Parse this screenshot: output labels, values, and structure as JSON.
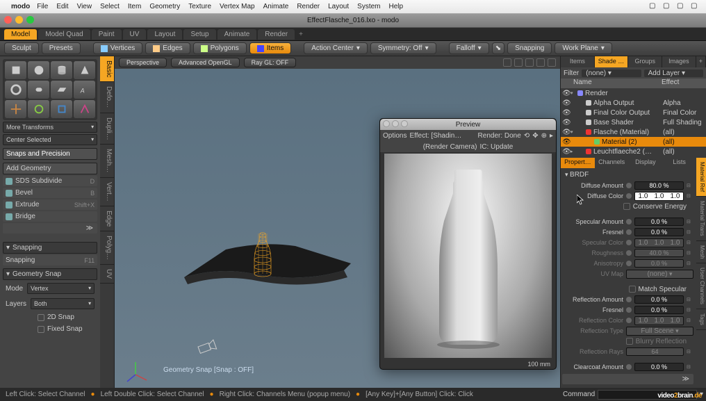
{
  "menubar": {
    "app": "modo",
    "items": [
      "File",
      "Edit",
      "View",
      "Select",
      "Item",
      "Geometry",
      "Texture",
      "Vertex Map",
      "Animate",
      "Render",
      "Layout",
      "System",
      "Help"
    ]
  },
  "window_title": "EffectFlasche_016.lxo - modo",
  "layout_tabs": [
    "Model",
    "Model Quad",
    "Paint",
    "UV",
    "Layout",
    "Setup",
    "Animate",
    "Render"
  ],
  "layout_active": 0,
  "left_toolbar": {
    "sculpt": "Sculpt",
    "presets": "Presets"
  },
  "select_modes": {
    "vertices": "Vertices",
    "edges": "Edges",
    "polygons": "Polygons",
    "items": "Items"
  },
  "toolbar": {
    "action_center": "Action Center",
    "symmetry": "Symmetry: Off",
    "falloff": "Falloff",
    "snapping": "Snapping",
    "workplane": "Work Plane"
  },
  "viewport_bar": {
    "perspective": "Perspective",
    "opengl": "Advanced OpenGL",
    "raygl": "Ray GL: OFF"
  },
  "left_panel": {
    "more_transforms": "More Transforms",
    "center_selected": "Center Selected",
    "snaps_precision": "Snaps and Precision",
    "add_geometry": "Add Geometry",
    "tools": [
      {
        "name": "SDS Subdivide",
        "sc": "D"
      },
      {
        "name": "Bevel",
        "sc": "B"
      },
      {
        "name": "Extrude",
        "sc": "Shift+X"
      },
      {
        "name": "Bridge",
        "sc": ""
      }
    ],
    "snapping_hdr": "Snapping",
    "snapping_btn": "Snapping",
    "snapping_sc": "F11",
    "geometry_snap": "Geometry Snap",
    "mode_label": "Mode",
    "mode_val": "Vertex",
    "layers_label": "Layers",
    "layers_val": "Both",
    "snap2d": "2D Snap",
    "fixed_snap": "Fixed Snap"
  },
  "viewport_status": "Geometry Snap  [Snap : OFF]",
  "preview": {
    "title": "Preview",
    "options": "Options",
    "effect": "Effect: [Shadin…",
    "render": "Render: Done",
    "camera_btn": "(Render Camera)",
    "ic_btn": "IC: Update",
    "scale": "100 mm"
  },
  "right_tabs_top": [
    "Items",
    "Shade …",
    "Groups",
    "Images"
  ],
  "right_tabs_top_active": 1,
  "filter": {
    "label": "Filter",
    "val": "(none)",
    "addlayer": "Add Layer"
  },
  "tree_hdr": {
    "name": "Name",
    "effect": "Effect"
  },
  "tree": [
    {
      "indent": 0,
      "icon": "#88f",
      "name": "Render",
      "effect": "",
      "tog": "▾"
    },
    {
      "indent": 1,
      "icon": "#ccc",
      "name": "Alpha Output",
      "effect": "Alpha"
    },
    {
      "indent": 1,
      "icon": "#ccc",
      "name": "Final Color Output",
      "effect": "Final Color"
    },
    {
      "indent": 1,
      "icon": "#ccc",
      "name": "Base Shader",
      "effect": "Full Shading"
    },
    {
      "indent": 1,
      "icon": "#e33",
      "name": "Flasche (Material)",
      "effect": "(all)",
      "tog": "▾"
    },
    {
      "indent": 2,
      "icon": "#6c6",
      "name": "Material (2)",
      "effect": "(all)",
      "sel": true
    },
    {
      "indent": 1,
      "icon": "#e33",
      "name": "Leuchtflaeche2 (…",
      "effect": "(all)",
      "tog": "▸"
    }
  ],
  "prop_tabs": [
    "Propert…",
    "Channels",
    "Display",
    "Lists"
  ],
  "prop_tabs_active": 0,
  "brdf": "BRDF",
  "props": {
    "diffuse_amount": {
      "label": "Diffuse Amount",
      "val": "80.0 %"
    },
    "diffuse_color": {
      "label": "Diffuse Color",
      "r": "1.0",
      "g": "1.0",
      "b": "1.0"
    },
    "conserve": "Conserve Energy",
    "specular_amount": {
      "label": "Specular Amount",
      "val": "0.0 %"
    },
    "fresnel": {
      "label": "Fresnel",
      "val": "0.0 %"
    },
    "specular_color": {
      "label": "Specular Color",
      "r": "1.0",
      "g": "1.0",
      "b": "1.0"
    },
    "roughness": {
      "label": "Roughness",
      "val": "40.0 %"
    },
    "anisotropy": {
      "label": "Anisotropy",
      "val": "0.0 %"
    },
    "uvmap": {
      "label": "UV Map",
      "val": "(none)"
    },
    "match_spec": "Match Specular",
    "refl_amount": {
      "label": "Reflection Amount",
      "val": "0.0 %"
    },
    "refl_fresnel": {
      "label": "Fresnel",
      "val": "0.0 %"
    },
    "refl_color": {
      "label": "Reflection Color",
      "r": "1.0",
      "g": "1.0",
      "b": "1.0"
    },
    "refl_type": {
      "label": "Reflection Type",
      "val": "Full Scene"
    },
    "blurry": "Blurry Reflection",
    "refl_rays": {
      "label": "Reflection Rays",
      "val": "64"
    },
    "clearcoat": {
      "label": "Clearcoat Amount",
      "val": "0.0 %"
    }
  },
  "right_side_tabs": [
    "Material Ref",
    "Material Trans",
    "Mesh",
    "User Channels",
    "Tags"
  ],
  "status": {
    "lc": "Left Click: Select Channel",
    "ldc": "Left Double Click: Select Channel",
    "rc": "Right Click: Channels Menu (popup menu)",
    "any": "[Any Key]+[Any Button] Click: Click"
  },
  "command_label": "Command",
  "watermark": {
    "a": "video",
    "b": "2",
    "c": "brain",
    "d": ".de"
  }
}
